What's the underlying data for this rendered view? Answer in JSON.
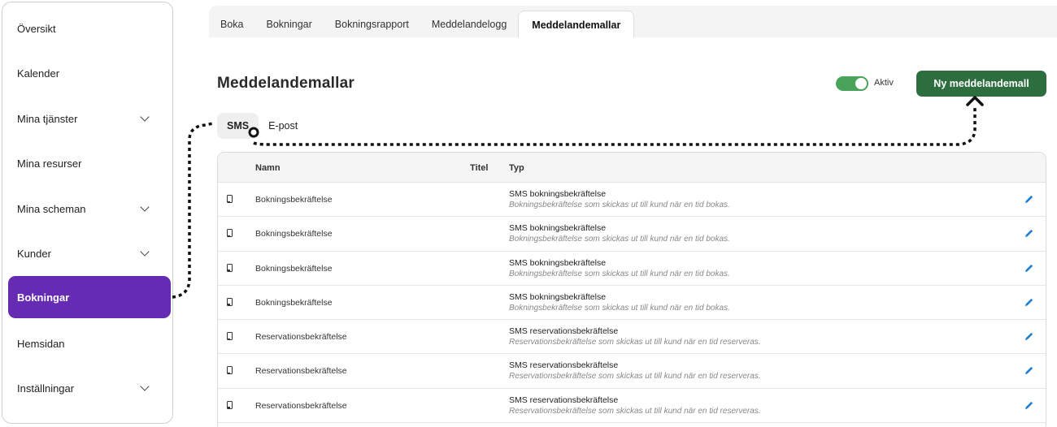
{
  "sidebar": {
    "items": [
      {
        "label": "Översikt",
        "expandable": false,
        "active": false
      },
      {
        "label": "Kalender",
        "expandable": false,
        "active": false
      },
      {
        "label": "Mina tjänster",
        "expandable": true,
        "active": false
      },
      {
        "label": "Mina resurser",
        "expandable": false,
        "active": false
      },
      {
        "label": "Mina scheman",
        "expandable": true,
        "active": false
      },
      {
        "label": "Kunder",
        "expandable": true,
        "active": false
      },
      {
        "label": "Bokningar",
        "expandable": false,
        "active": true
      },
      {
        "label": "Hemsidan",
        "expandable": false,
        "active": false
      },
      {
        "label": "Inställningar",
        "expandable": true,
        "active": false
      }
    ]
  },
  "tabs": [
    "Boka",
    "Bokningar",
    "Bokningsrapport",
    "Meddelandelogg",
    "Meddelandemallar"
  ],
  "active_tab": "Meddelandemallar",
  "page": {
    "title": "Meddelandemallar",
    "toggle_label": "Aktiv",
    "toggle_on": true,
    "new_button": "Ny meddelandemall"
  },
  "subtabs": [
    "SMS",
    "E-post"
  ],
  "active_subtab": "SMS",
  "table": {
    "headers": {
      "name": "Namn",
      "title": "Titel",
      "type": "Typ"
    },
    "rows": [
      {
        "name": "Bokningsbekräftelse",
        "title": "",
        "type": "SMS bokningsbekräftelse",
        "desc": "Bokningsbekräftelse som skickas ut till kund när en tid bokas."
      },
      {
        "name": "Bokningsbekräftelse",
        "title": "",
        "type": "SMS bokningsbekräftelse",
        "desc": "Bokningsbekräftelse som skickas ut till kund när en tid bokas."
      },
      {
        "name": "Bokningsbekräftelse",
        "title": "",
        "type": "SMS bokningsbekräftelse",
        "desc": "Bokningsbekräftelse som skickas ut till kund när en tid bokas."
      },
      {
        "name": "Bokningsbekräftelse",
        "title": "",
        "type": "SMS bokningsbekräftelse",
        "desc": "Bokningsbekräftelse som skickas ut till kund när en tid bokas."
      },
      {
        "name": "Reservationsbekräftelse",
        "title": "",
        "type": "SMS reservationsbekräftelse",
        "desc": "Reservationsbekräftelse som skickas ut till kund när en tid reserveras."
      },
      {
        "name": "Reservationsbekräftelse",
        "title": "",
        "type": "SMS reservationsbekräftelse",
        "desc": "Reservationsbekräftelse som skickas ut till kund när en tid reserveras."
      },
      {
        "name": "Reservationsbekräftelse",
        "title": "",
        "type": "SMS reservationsbekräftelse",
        "desc": "Reservationsbekräftelse som skickas ut till kund när en tid reserveras."
      }
    ]
  },
  "icons": {
    "row_icon": "phone-icon",
    "row_action": "edit-pencil-icon",
    "sidebar_expand": "chevron-down-icon"
  },
  "colors": {
    "sidebar_active": "#652cb3",
    "primary_button": "#2d6e3f",
    "toggle_on": "#4aa35b",
    "edit_icon": "#1f7fd0"
  }
}
